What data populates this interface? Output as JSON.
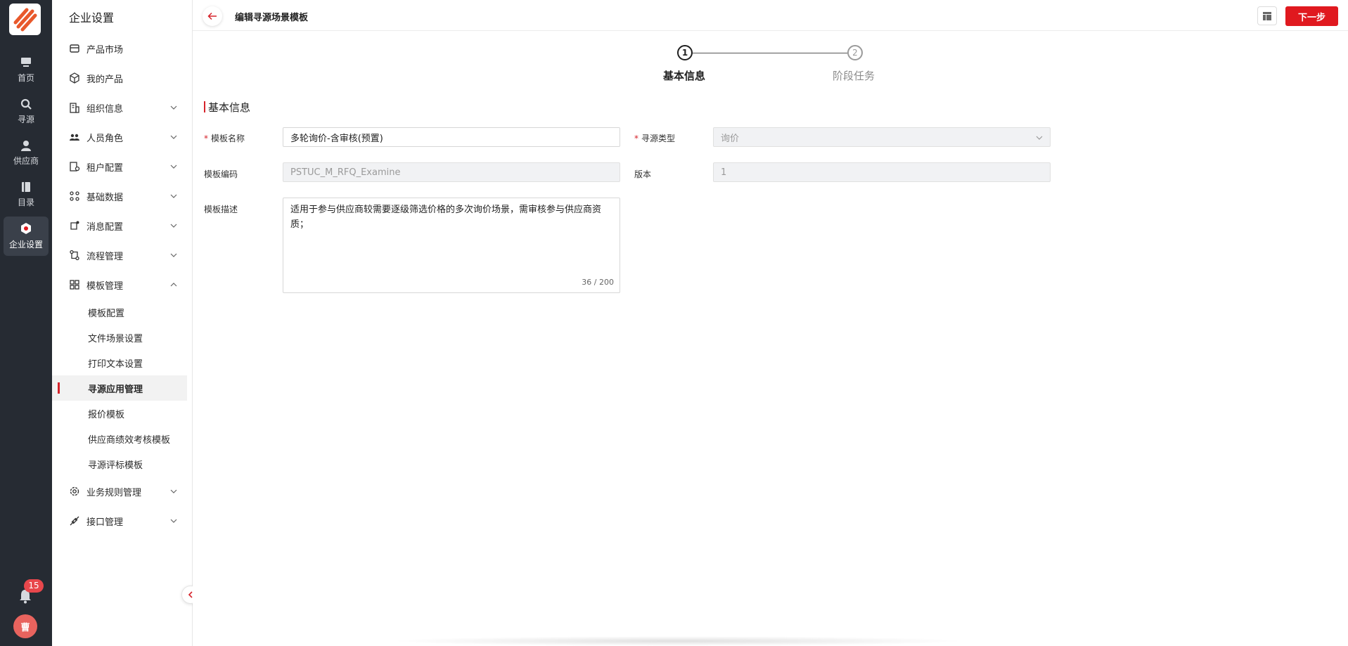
{
  "rail": {
    "items": [
      {
        "label": "首页",
        "icon": "monitor-icon"
      },
      {
        "label": "寻源",
        "icon": "search-icon"
      },
      {
        "label": "供应商",
        "icon": "user-icon"
      },
      {
        "label": "目录",
        "icon": "book-icon"
      },
      {
        "label": "企业设置",
        "icon": "settings-hex-icon"
      }
    ],
    "notification_count": "15",
    "avatar_text": "曹"
  },
  "sidebar": {
    "title": "企业设置",
    "items": [
      {
        "label": "产品市场",
        "icon": "store-icon"
      },
      {
        "label": "我的产品",
        "icon": "box-icon"
      },
      {
        "label": "组织信息",
        "icon": "building-icon"
      },
      {
        "label": "人员角色",
        "icon": "people-icon"
      },
      {
        "label": "租户配置",
        "icon": "tenant-icon"
      },
      {
        "label": "基础数据",
        "icon": "data-icon"
      },
      {
        "label": "消息配置",
        "icon": "message-icon"
      },
      {
        "label": "流程管理",
        "icon": "flow-icon"
      },
      {
        "label": "模板管理",
        "icon": "template-icon"
      },
      {
        "label": "业务规则管理",
        "icon": "gear-icon"
      },
      {
        "label": "接口管理",
        "icon": "plug-icon"
      }
    ],
    "template_sub_items": [
      {
        "label": "模板配置"
      },
      {
        "label": "文件场景设置"
      },
      {
        "label": "打印文本设置"
      },
      {
        "label": "寻源应用管理"
      },
      {
        "label": "报价模板"
      },
      {
        "label": "供应商绩效考核模板"
      },
      {
        "label": "寻源评标模板"
      }
    ]
  },
  "header": {
    "title": "编辑寻源场景模板",
    "next_label": "下一步"
  },
  "steps": [
    {
      "number": "1",
      "label": "基本信息"
    },
    {
      "number": "2",
      "label": "阶段任务"
    }
  ],
  "form": {
    "section_title": "基本信息",
    "template_name": {
      "label": "模板名称",
      "value": "多轮询价-含审核(预置)"
    },
    "sourcing_type": {
      "label": "寻源类型",
      "value": "询价"
    },
    "template_code": {
      "label": "模板编码",
      "value": "PSTUC_M_RFQ_Examine"
    },
    "version": {
      "label": "版本",
      "value": "1"
    },
    "description": {
      "label": "模板描述",
      "value": "适用于参与供应商较需要逐级筛选价格的多次询价场景，需审核参与供应商资质；",
      "counter": "36 / 200"
    },
    "required_mark": "*"
  },
  "colors": {
    "accent": "#e0191f",
    "rail_bg": "#262b33"
  }
}
